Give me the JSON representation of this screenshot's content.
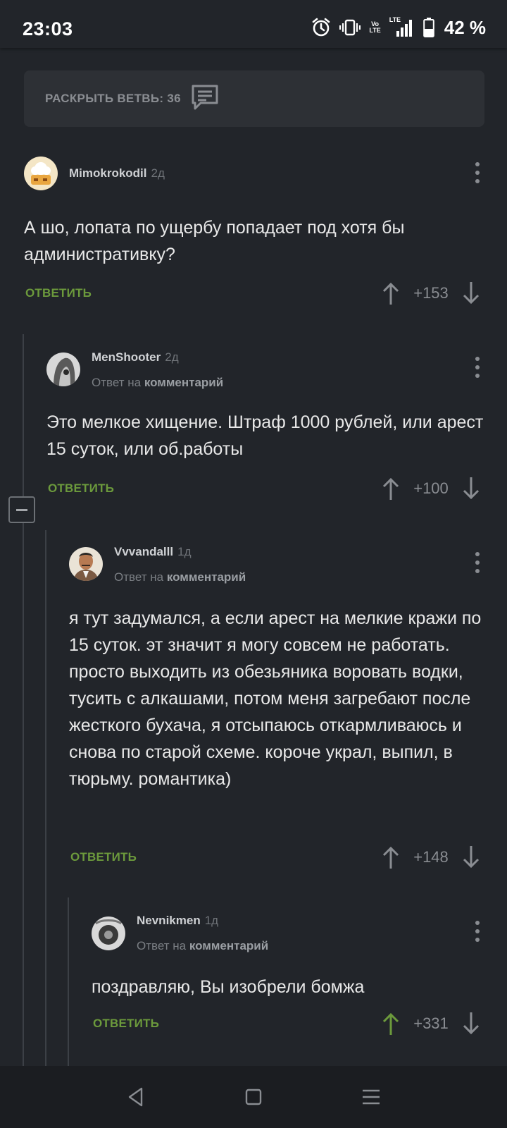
{
  "status_bar": {
    "time": "23:03",
    "battery": "42 %",
    "net_top": "Vo",
    "net_bottom": "LTE",
    "lte": "LTE"
  },
  "thread": {
    "expand_label": "РАСКРЫТЬ ВЕТВЬ: 36"
  },
  "comments": [
    {
      "author": "Mimokrokodil",
      "age": "2д",
      "body": "А шо, лопата по ущербу попадает под хотя бы административку?",
      "reply_label": "ОТВЕТИТЬ",
      "score": "+153"
    },
    {
      "author": "MenShooter",
      "age": "2д",
      "reply_prefix": "Ответ на",
      "reply_target": "комментарий",
      "body": "Это мелкое хищение.  Штраф 1000 рублей, или арест 15 суток,  или об.работы",
      "reply_label": "ОТВЕТИТЬ",
      "score": "+100"
    },
    {
      "author": "Vvvandalll",
      "age": "1д",
      "reply_prefix": "Ответ на",
      "reply_target": "комментарий",
      "body": "я тут задумался, а если арест на мелкие кражи по 15 суток. эт значит я могу совсем не работать. просто выходить из обезьяника воровать водки, тусить с алкашами, потом меня загребают после жесткого бухача, я отсыпаюсь откармливаюсь и снова по старой схеме. короче украл, выпил, в тюрьму. романтика)",
      "reply_label": "ОТВЕТИТЬ",
      "score": "+148"
    },
    {
      "author": "Nevnikmen",
      "age": "1д",
      "reply_prefix": "Ответ на",
      "reply_target": "комментарий",
      "body": "поздравляю, Вы изобрели бомжа",
      "reply_label": "ОТВЕТИТЬ",
      "score": "+331",
      "upvoted": true
    }
  ],
  "colors": {
    "background": "#22252a",
    "accent_green": "#6c9a3c",
    "muted": "#8a8d92"
  },
  "icons": [
    "alarm-icon",
    "vibrate-icon",
    "signal-icon",
    "battery-icon",
    "comments-icon",
    "more-icon",
    "arrow-up-icon",
    "arrow-down-icon",
    "back-icon",
    "home-icon",
    "menu-icon"
  ]
}
